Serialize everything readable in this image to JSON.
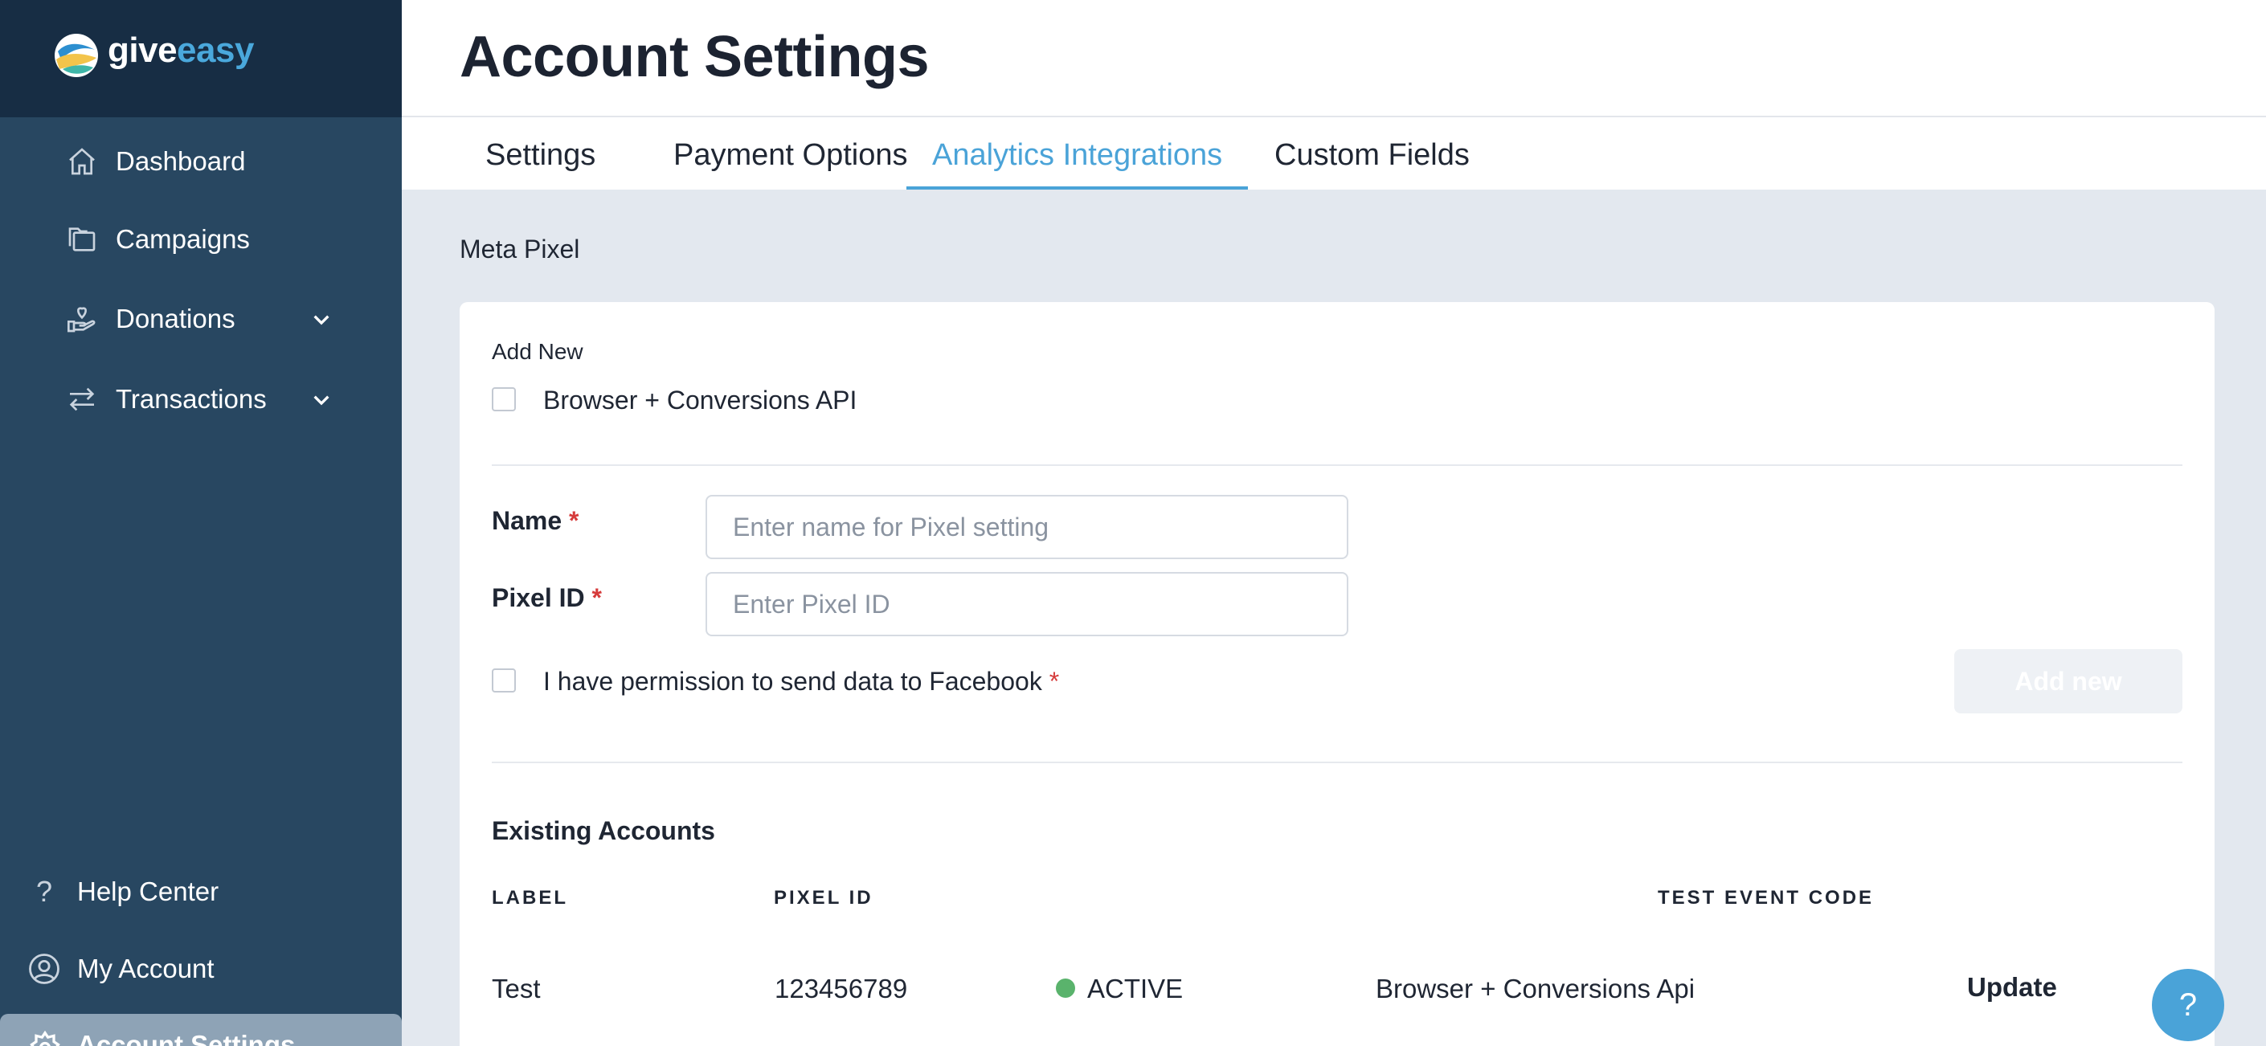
{
  "brand": {
    "name_part1": "give",
    "name_part2": "easy",
    "accent": "#4aa8dc"
  },
  "sidebar": {
    "items": [
      {
        "label": "Dashboard",
        "icon": "home-icon"
      },
      {
        "label": "Campaigns",
        "icon": "folders-icon"
      },
      {
        "label": "Donations",
        "icon": "hand-heart-icon",
        "has_submenu": true
      },
      {
        "label": "Transactions",
        "icon": "arrows-exchange-icon",
        "has_submenu": true
      }
    ],
    "bottom_items": [
      {
        "label": "Help Center",
        "icon": "question-icon"
      },
      {
        "label": "My Account",
        "icon": "user-circle-icon"
      }
    ],
    "active_item": {
      "label": "Account Settings",
      "icon": "gear-icon"
    }
  },
  "header": {
    "title": "Account Settings"
  },
  "tabs": [
    {
      "label": "Settings",
      "active": false
    },
    {
      "label": "Payment Options",
      "active": false
    },
    {
      "label": "Analytics Integrations",
      "active": true
    },
    {
      "label": "Custom Fields",
      "active": false
    }
  ],
  "main": {
    "section_title": "Meta Pixel",
    "add_new": {
      "heading": "Add New",
      "browser_checkbox_label": "Browser + Conversions API",
      "name_label": "Name",
      "name_placeholder": "Enter name for Pixel setting",
      "pixel_label": "Pixel ID",
      "pixel_placeholder": "Enter Pixel ID",
      "permission_label": "I have permission to send data to Facebook",
      "required_mark": "*",
      "button_label": "Add new"
    },
    "existing": {
      "title": "Existing Accounts",
      "columns": [
        "LABEL",
        "PIXEL ID",
        "TEST EVENT CODE"
      ],
      "rows": [
        {
          "label": "Test",
          "pixel_id": "123456789",
          "status": "ACTIVE",
          "status_color": "#5ab36c",
          "mode": "Browser + Conversions Api",
          "action": "Update"
        }
      ]
    }
  },
  "help_button": {
    "label": "?"
  }
}
